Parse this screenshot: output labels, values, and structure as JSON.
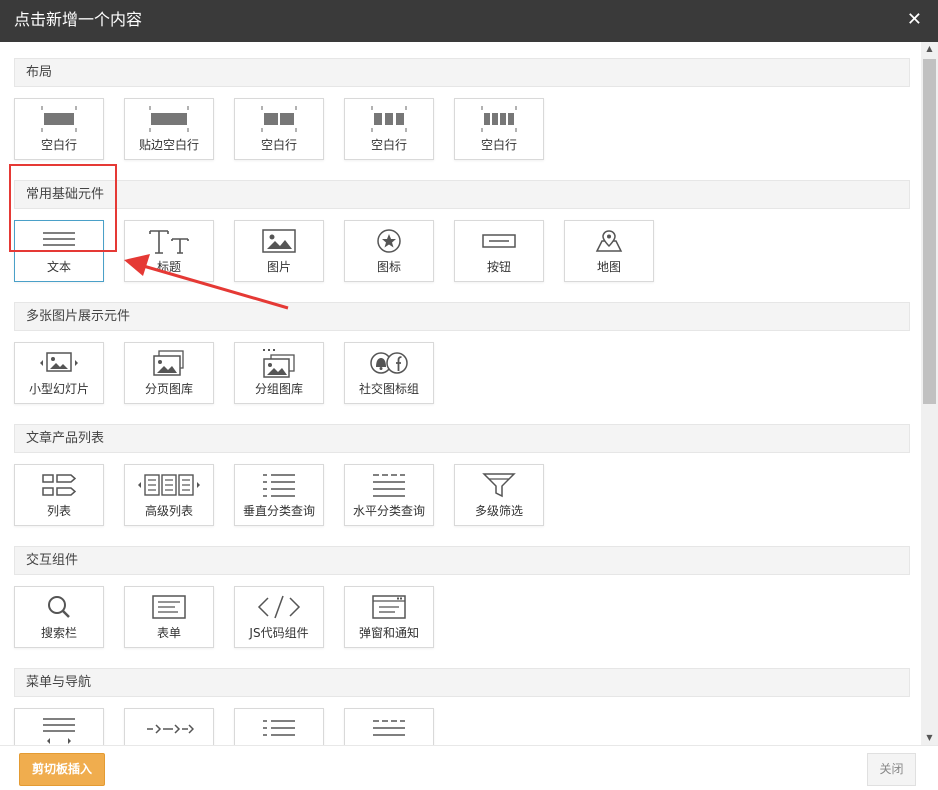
{
  "dialog": {
    "title": "点击新增一个内容",
    "close_symbol": "✕"
  },
  "sections": [
    {
      "title": "布局",
      "items": [
        {
          "label": "空白行",
          "icon": "blank-row-1-icon"
        },
        {
          "label": "贴边空白行",
          "icon": "edge-blank-row-icon"
        },
        {
          "label": "空白行",
          "icon": "blank-row-2-icon"
        },
        {
          "label": "空白行",
          "icon": "blank-row-3-icon"
        },
        {
          "label": "空白行",
          "icon": "blank-row-4-icon"
        }
      ]
    },
    {
      "title": "常用基础元件",
      "items": [
        {
          "label": "文本",
          "icon": "text-lines-icon"
        },
        {
          "label": "标题",
          "icon": "title-tt-icon"
        },
        {
          "label": "图片",
          "icon": "image-icon"
        },
        {
          "label": "图标",
          "icon": "star-circle-icon"
        },
        {
          "label": "按钮",
          "icon": "button-icon"
        },
        {
          "label": "地图",
          "icon": "map-pin-icon"
        }
      ]
    },
    {
      "title": "多张图片展示元件",
      "items": [
        {
          "label": "小型幻灯片",
          "icon": "slideshow-icon"
        },
        {
          "label": "分页图库",
          "icon": "paged-gallery-icon"
        },
        {
          "label": "分组图库",
          "icon": "grouped-gallery-icon"
        },
        {
          "label": "社交图标组",
          "icon": "social-icons-icon"
        }
      ]
    },
    {
      "title": "文章产品列表",
      "items": [
        {
          "label": "列表",
          "icon": "list-icon"
        },
        {
          "label": "高级列表",
          "icon": "advanced-list-icon"
        },
        {
          "label": "垂直分类查询",
          "icon": "vertical-category-icon"
        },
        {
          "label": "水平分类查询",
          "icon": "horizontal-category-icon"
        },
        {
          "label": "多级筛选",
          "icon": "filter-funnel-icon"
        }
      ]
    },
    {
      "title": "交互组件",
      "items": [
        {
          "label": "搜索栏",
          "icon": "search-icon"
        },
        {
          "label": "表单",
          "icon": "form-icon"
        },
        {
          "label": "JS代码组件",
          "icon": "code-icon"
        },
        {
          "label": "弹窗和通知",
          "icon": "popup-notice-icon"
        }
      ]
    },
    {
      "title": "菜单与导航",
      "items": [
        {
          "label": "",
          "icon": "menu-lines-icon"
        },
        {
          "label": "",
          "icon": "breadcrumb-arrows-icon"
        },
        {
          "label": "",
          "icon": "list-menu-icon"
        },
        {
          "label": "",
          "icon": "menu-dashed-icon"
        }
      ]
    }
  ],
  "footer": {
    "paste_label": "剪切板插入",
    "close_label": "关闭"
  },
  "colors": {
    "titlebar": "#3a3a3a",
    "paste_button": "#f0ad4e",
    "highlight": "#e53935",
    "active_border": "#4aa0c8",
    "icon": "#555555"
  }
}
